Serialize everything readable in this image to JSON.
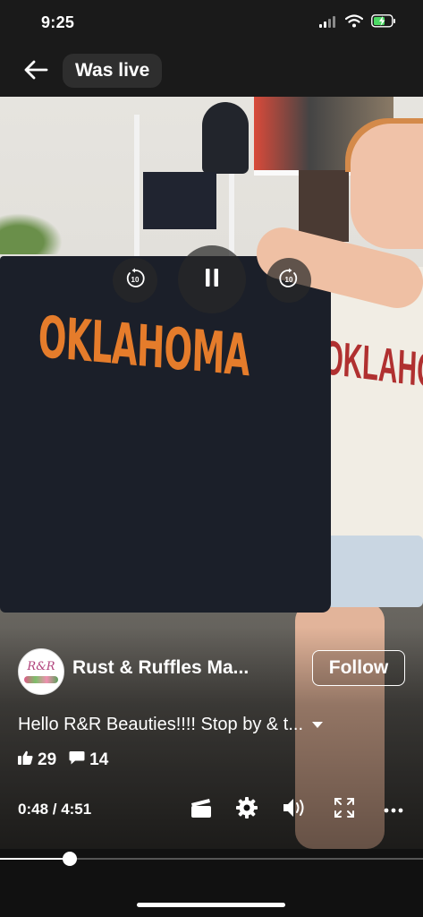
{
  "status_bar": {
    "time": "9:25",
    "icons": [
      "cellular-signal-icon",
      "wifi-icon",
      "battery-charging-icon"
    ]
  },
  "header": {
    "back_icon": "arrow-left-icon",
    "title": "Was live"
  },
  "video": {
    "shirt_text": "OKLAHOMA",
    "person_shirt_text": "OKLAHO",
    "controls": {
      "skip_back_label": "10",
      "skip_forward_label": "10",
      "state": "playing"
    }
  },
  "post": {
    "page_name": "Rust & Ruffles Ma...",
    "avatar_logo_text": "R&R",
    "follow_label": "Follow",
    "description": "Hello R&R Beauties!!!!  Stop by & t...",
    "likes": "29",
    "comments": "14"
  },
  "player": {
    "time_display": "0:48 / 4:51",
    "progress_fraction": 0.165,
    "icons": [
      "clapperboard-icon",
      "settings-gear-icon",
      "volume-icon",
      "fullscreen-icon",
      "more-options-icon"
    ]
  },
  "colors": {
    "background": "#111111",
    "accent": "#ffffff",
    "shirt_print": "#e57c2b"
  }
}
